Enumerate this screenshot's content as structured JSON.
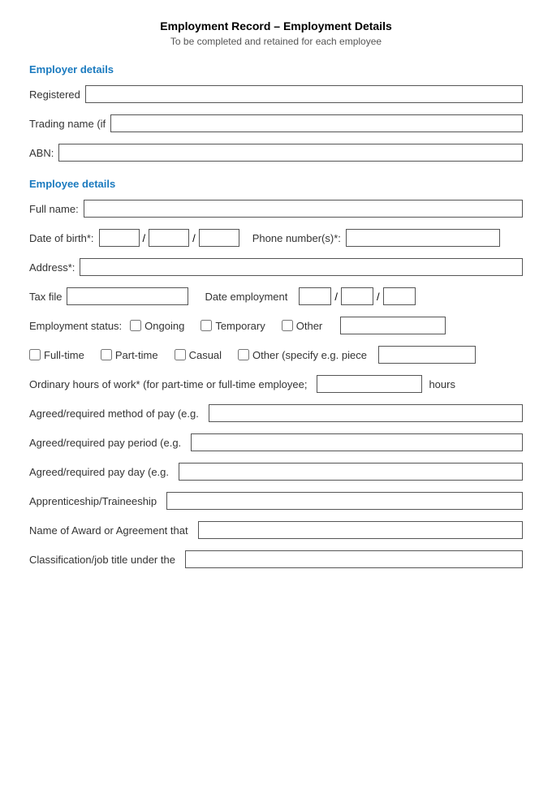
{
  "title": "Employment Record – Employment Details",
  "subtitle": "To be completed and retained for each employee",
  "sections": {
    "employer": {
      "heading": "Employer details",
      "fields": {
        "registered_label": "Registered",
        "trading_name_label": "Trading name (if",
        "abn_label": "ABN:"
      }
    },
    "employee": {
      "heading": "Employee details",
      "fields": {
        "full_name_label": "Full name:",
        "dob_label": "Date of birth*:",
        "phone_label": "Phone number(s)*:",
        "address_label": "Address*:",
        "tax_file_label": "Tax file",
        "date_employment_label": "Date employment",
        "employment_status_label": "Employment status:",
        "ongoing_label": "Ongoing",
        "temporary_label": "Temporary",
        "other_status_label": "Other",
        "fulltime_label": "Full-time",
        "parttime_label": "Part-time",
        "casual_label": "Casual",
        "other_type_label": "Other (specify e.g. piece",
        "ordinary_hours_label": "Ordinary hours of work* (for part-time or full-time employee;",
        "hours_suffix": "hours",
        "pay_method_label": "Agreed/required method of pay (e.g.",
        "pay_period_label": "Agreed/required pay period (e.g.",
        "pay_day_label": "Agreed/required pay day (e.g.",
        "apprenticeship_label": "Apprenticeship/Traineeship",
        "award_label": "Name of Award or Agreement that",
        "classification_label": "Classification/job title under the"
      }
    }
  }
}
